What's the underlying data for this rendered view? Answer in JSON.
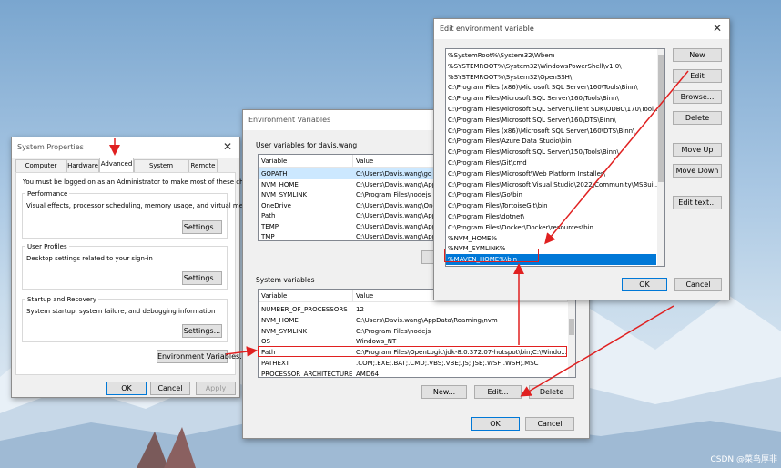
{
  "sys_props": {
    "title": "System Properties",
    "tabs": [
      "Computer Name",
      "Hardware",
      "Advanced",
      "System Protection",
      "Remote"
    ],
    "admin_note": "You must be logged on as an Administrator to make most of these changes.",
    "performance": {
      "title": "Performance",
      "desc": "Visual effects, processor scheduling, memory usage, and virtual memory",
      "btn": "Settings..."
    },
    "profiles": {
      "title": "User Profiles",
      "desc": "Desktop settings related to your sign-in",
      "btn": "Settings..."
    },
    "startup": {
      "title": "Startup and Recovery",
      "desc": "System startup, system failure, and debugging information",
      "btn": "Settings..."
    },
    "env_btn": "Environment Variables...",
    "ok": "OK",
    "cancel": "Cancel",
    "apply": "Apply"
  },
  "env_vars": {
    "title": "Environment Variables",
    "user_label": "User variables for davis.wang",
    "col_variable": "Variable",
    "col_value": "Value",
    "user_rows": [
      {
        "name": "GOPATH",
        "value": "C:\\Users\\Davis.wang\\go"
      },
      {
        "name": "NVM_HOME",
        "value": "C:\\Users\\Davis.wang\\AppD"
      },
      {
        "name": "NVM_SYMLINK",
        "value": "C:\\Program Files\\nodejs"
      },
      {
        "name": "OneDrive",
        "value": "C:\\Users\\Davis.wang\\OneD"
      },
      {
        "name": "Path",
        "value": "C:\\Users\\Davis.wang\\AppD"
      },
      {
        "name": "TEMP",
        "value": "C:\\Users\\Davis.wang\\AppD"
      },
      {
        "name": "TMP",
        "value": "C:\\Users\\Davis.wang\\AppD"
      }
    ],
    "sys_label": "System variables",
    "sys_rows": [
      {
        "name": "NUMBER_OF_PROCESSORS",
        "value": "12"
      },
      {
        "name": "NVM_HOME",
        "value": "C:\\Users\\Davis.wang\\AppData\\Roaming\\nvm"
      },
      {
        "name": "NVM_SYMLINK",
        "value": "C:\\Program Files\\nodejs"
      },
      {
        "name": "OS",
        "value": "Windows_NT"
      },
      {
        "name": "Path",
        "value": "C:\\Program Files\\OpenLogic\\jdk-8.0.372.07-hotspot\\bin;C:\\Windo..."
      },
      {
        "name": "PATHEXT",
        "value": ".COM;.EXE;.BAT;.CMD;.VBS;.VBE;.JS;.JSE;.WSF;.WSH;.MSC"
      },
      {
        "name": "PROCESSOR_ARCHITECTURE",
        "value": "AMD64"
      }
    ],
    "new_btn": "New...",
    "edit_btn": "Edit...",
    "delete_btn": "Delete",
    "ok": "OK",
    "cancel": "Cancel"
  },
  "edit_env": {
    "title": "Edit environment variable",
    "items": [
      "%SystemRoot%\\System32\\Wbem",
      "%SYSTEMROOT%\\System32\\WindowsPowerShell\\v1.0\\",
      "%SYSTEMROOT%\\System32\\OpenSSH\\",
      "C:\\Program Files (x86)\\Microsoft SQL Server\\160\\Tools\\Binn\\",
      "C:\\Program Files\\Microsoft SQL Server\\160\\Tools\\Binn\\",
      "C:\\Program Files\\Microsoft SQL Server\\Client SDK\\ODBC\\170\\Tool...",
      "C:\\Program Files\\Microsoft SQL Server\\160\\DTS\\Binn\\",
      "C:\\Program Files (x86)\\Microsoft SQL Server\\160\\DTS\\Binn\\",
      "C:\\Program Files\\Azure Data Studio\\bin",
      "C:\\Program Files\\Microsoft SQL Server\\150\\Tools\\Binn\\",
      "C:\\Program Files\\Git\\cmd",
      "C:\\Program Files\\Microsoft\\Web Platform Installer\\",
      "C:\\Program Files\\Microsoft Visual Studio\\2022\\Community\\MSBui...",
      "C:\\Program Files\\Go\\bin",
      "C:\\Program Files\\TortoiseGit\\bin",
      "C:\\Program Files\\dotnet\\",
      "C:\\Program Files\\Docker\\Docker\\resources\\bin",
      "%NVM_HOME%",
      "%NVM_SYMLINK%",
      "%MAVEN_HOME%\\bin"
    ],
    "selected_index": 19,
    "new_btn": "New",
    "edit_btn": "Edit",
    "browse_btn": "Browse...",
    "delete_btn": "Delete",
    "move_up_btn": "Move Up",
    "move_down_btn": "Move Down",
    "edit_text_btn": "Edit text...",
    "ok": "OK",
    "cancel": "Cancel"
  },
  "watermark": "CSDN @菜鸟厚非",
  "colors": {
    "annotation": "#e02020",
    "selection": "#0078d7"
  }
}
